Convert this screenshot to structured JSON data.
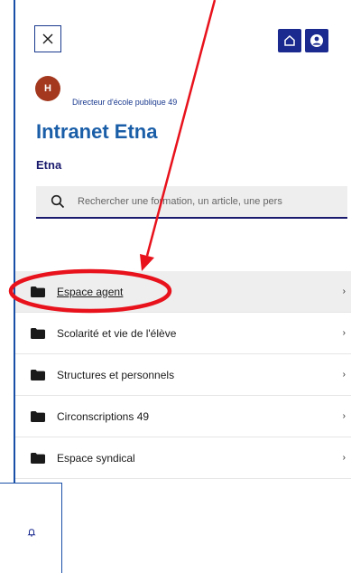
{
  "header": {
    "close_icon": "close-icon",
    "home_icon": "home-icon",
    "user_icon": "user-icon"
  },
  "profile": {
    "avatar_initial": "H",
    "role": "Directeur d'école publique 49"
  },
  "app": {
    "title": "Intranet Etna",
    "section": "Etna"
  },
  "search": {
    "placeholder": "Rechercher une formation, un article, une pers"
  },
  "menu": {
    "items": [
      {
        "label": "Espace agent",
        "active": true
      },
      {
        "label": "Scolarité et vie de l'élève"
      },
      {
        "label": "Structures et personnels"
      },
      {
        "label": "Circonscriptions 49"
      },
      {
        "label": "Espace syndical"
      }
    ],
    "chevron": "›"
  },
  "colors": {
    "accent": "#1a2a8f",
    "title": "#1a5ea8",
    "annotation": "#e8121c",
    "avatar": "#a3381e"
  }
}
